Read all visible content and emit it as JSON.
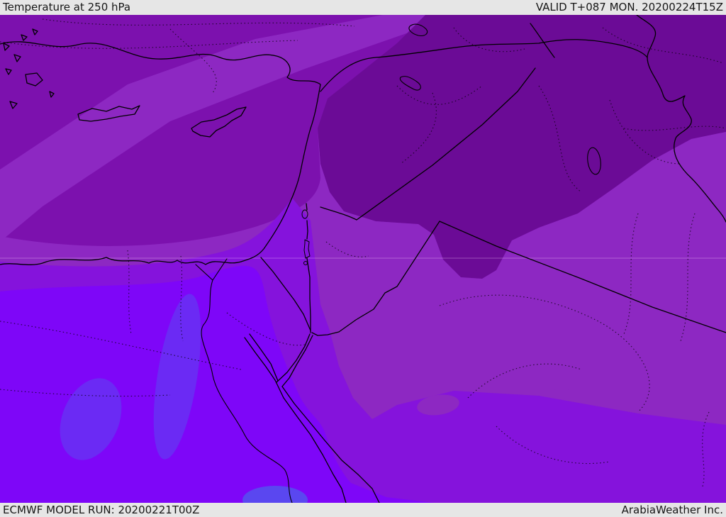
{
  "header": {
    "title": "Temperature at 250 hPa",
    "validity": "VALID T+087 MON. 20200224T15Z"
  },
  "footer": {
    "model_run": "ECMWF MODEL RUN: 20200221T00Z",
    "provider": "ArabiaWeather Inc."
  },
  "map": {
    "description": "Filled temperature contour map at 250 hPa over the Eastern Mediterranean and Middle East (Turkey, Cyprus, Syria, Iraq, Iran edge, Jordan, Israel, Egypt, Saudi Arabia)",
    "palette": {
      "band1_darkest_purple": "#6b0b96",
      "band2_dark_purple": "#7c11ae",
      "band3_medium_purple": "#8d28c2",
      "band4_violet": "#8513dc",
      "band5_bright_violet": "#7e06f8",
      "band6_blue_violet": "#6b2af4",
      "band7_bluest": "#5a47f0",
      "line_black": "#000000",
      "gridline_pink": "#ffd7ff"
    }
  }
}
